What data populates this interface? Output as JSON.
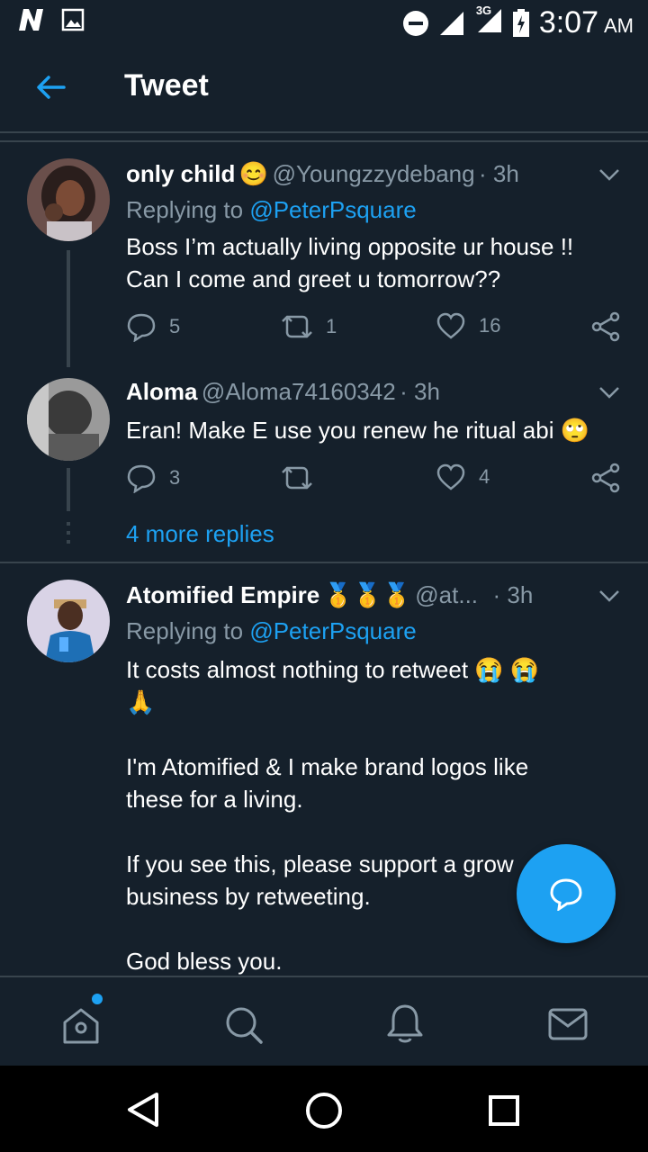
{
  "status_bar": {
    "time": "3:07",
    "ampm": "AM",
    "network": "3G"
  },
  "header": {
    "title": "Tweet"
  },
  "tweets": [
    {
      "name": "only child",
      "name_emoji": "😊",
      "handle": "@Youngzzydebang",
      "time": "· 3h",
      "replying_prefix": "Replying to",
      "replying_to": "@PeterPsquare",
      "text_line1": "Boss I’m actually living opposite ur house !!",
      "text_line2": "Can I come and greet u tomorrow??",
      "replies": "5",
      "retweets": "1",
      "likes": "16"
    },
    {
      "name": "Aloma",
      "handle": "@Aloma74160342",
      "time": "· 3h",
      "text_line1": "Eran! Make E use you renew he ritual abi",
      "text_emoji": "🙄",
      "replies": "3",
      "retweets": "",
      "likes": "4"
    },
    {
      "name": "Atomified Empire",
      "name_emoji": "🥇🥇🥇",
      "handle": "@at...",
      "time": "· 3h",
      "replying_prefix": "Replying to",
      "replying_to": "@PeterPsquare",
      "text_line1": "It costs almost nothing to retweet",
      "text_line1_emoji": "😭 😭",
      "text_line2_emoji": "🙏",
      "text_line3": "I'm Atomified & I make brand logos like",
      "text_line4": "these for a living.",
      "text_line5": "If you see this, please support a grow",
      "text_line6": "business by retweeting.",
      "text_line7": "God bless you."
    }
  ],
  "more_replies": "4 more replies",
  "icons": {
    "back": "back-arrow-icon",
    "reply": "reply-icon",
    "retweet": "retweet-icon",
    "like": "heart-icon",
    "share": "share-icon",
    "compose": "compose-reply-icon",
    "home": "home-icon",
    "search": "search-icon",
    "notifications": "bell-icon",
    "messages": "mail-icon"
  },
  "colors": {
    "background": "#15202b",
    "accent": "#1da1f2",
    "muted": "#8899a6",
    "divider": "#38444d"
  }
}
